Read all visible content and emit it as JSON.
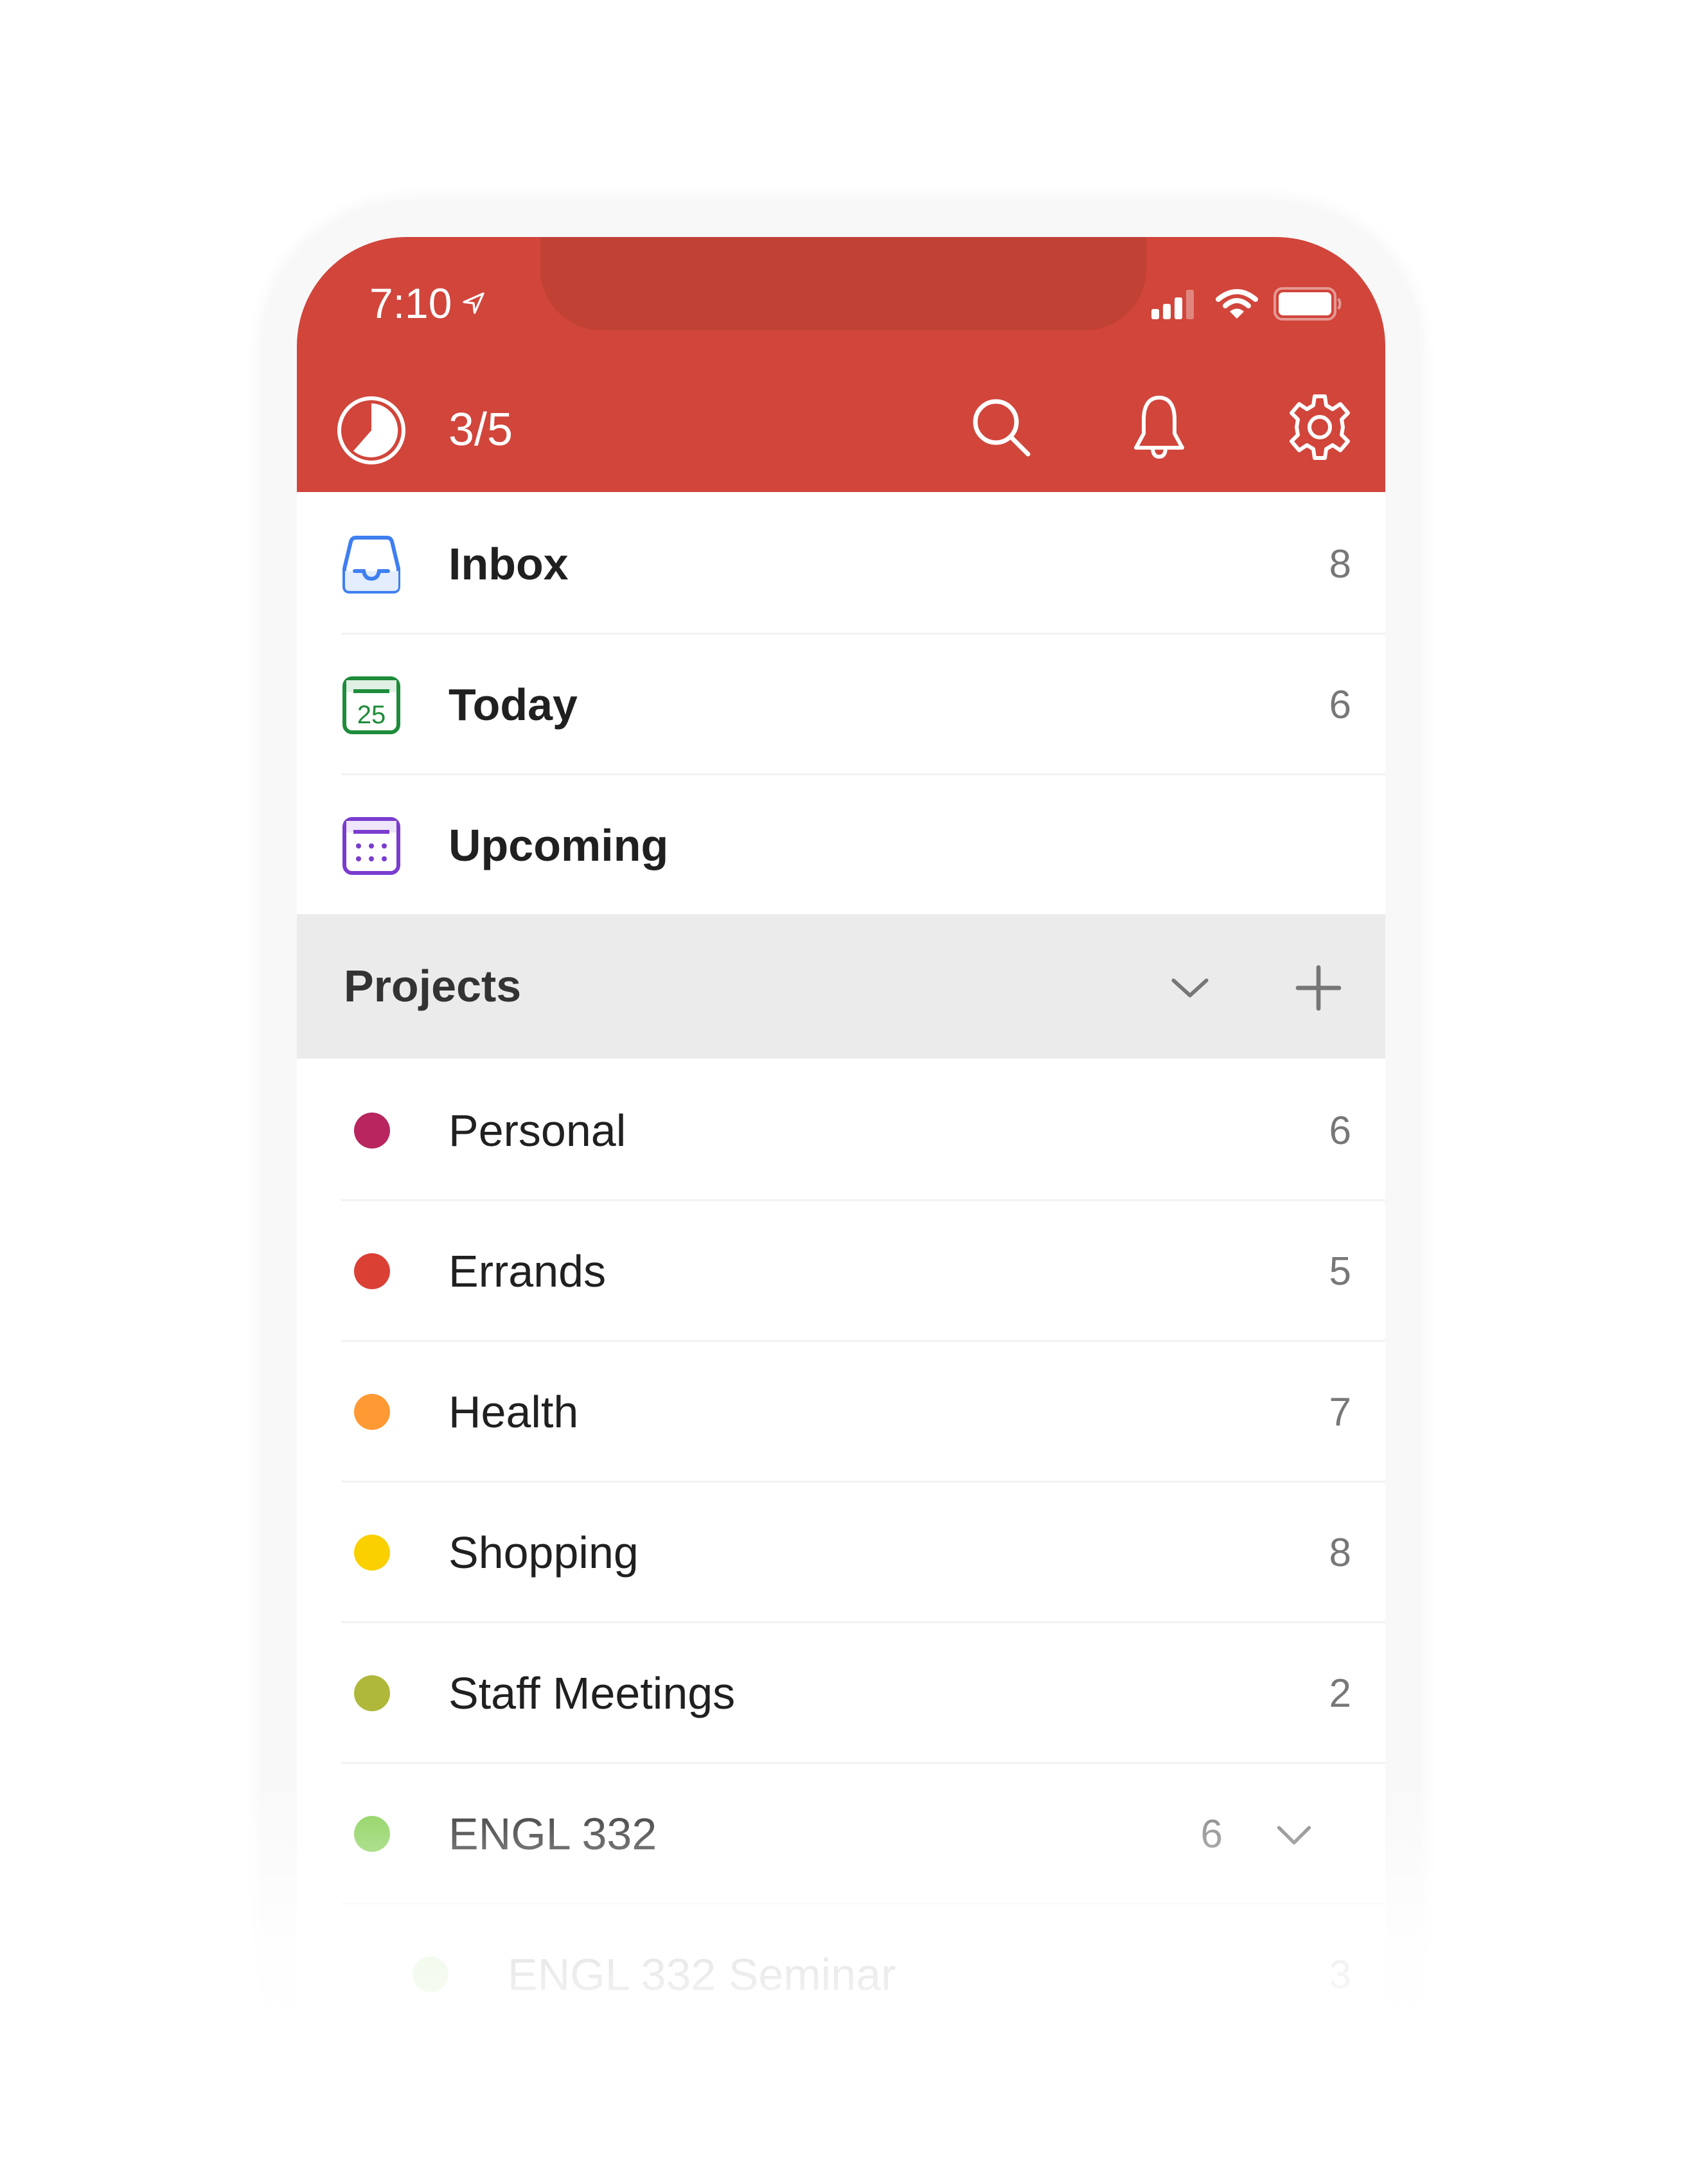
{
  "status_bar": {
    "time": "7:10",
    "icons": [
      "location-arrow-icon",
      "cellular-signal-icon",
      "wifi-icon",
      "battery-icon"
    ]
  },
  "header": {
    "karma_progress": "3/5",
    "karma_fraction": 0.6,
    "icons": [
      "karma-pie-icon",
      "search-icon",
      "bell-icon",
      "gear-icon"
    ]
  },
  "nav": [
    {
      "label": "Inbox",
      "count": "8",
      "icon": "inbox-icon",
      "color": "#3f7ff0"
    },
    {
      "label": "Today",
      "count": "6",
      "icon": "calendar-today-icon",
      "icon_text": "25",
      "color": "#1e8c3a"
    },
    {
      "label": "Upcoming",
      "count": "",
      "icon": "calendar-upcoming-icon",
      "color": "#7a3ccf"
    }
  ],
  "projects_section": {
    "title": "Projects",
    "icons": [
      "chevron-down-icon",
      "plus-icon"
    ]
  },
  "projects": [
    {
      "label": "Personal",
      "count": "6",
      "color": "#b8255f"
    },
    {
      "label": "Errands",
      "count": "5",
      "color": "#db4035"
    },
    {
      "label": "Health",
      "count": "7",
      "color": "#ff9933"
    },
    {
      "label": "Shopping",
      "count": "8",
      "color": "#fad000"
    },
    {
      "label": "Staff Meetings",
      "count": "2",
      "color": "#afb83b"
    },
    {
      "label": "ENGL 332",
      "count": "6",
      "color": "#7ecc49",
      "expandable": true
    },
    {
      "label": "ENGL 332 Seminar",
      "count": "3",
      "color": "#7ecc49",
      "subproject": true
    }
  ],
  "colors": {
    "brand_red": "#d1453b",
    "notch": "#c14134",
    "section_bg": "#ebebeb"
  }
}
